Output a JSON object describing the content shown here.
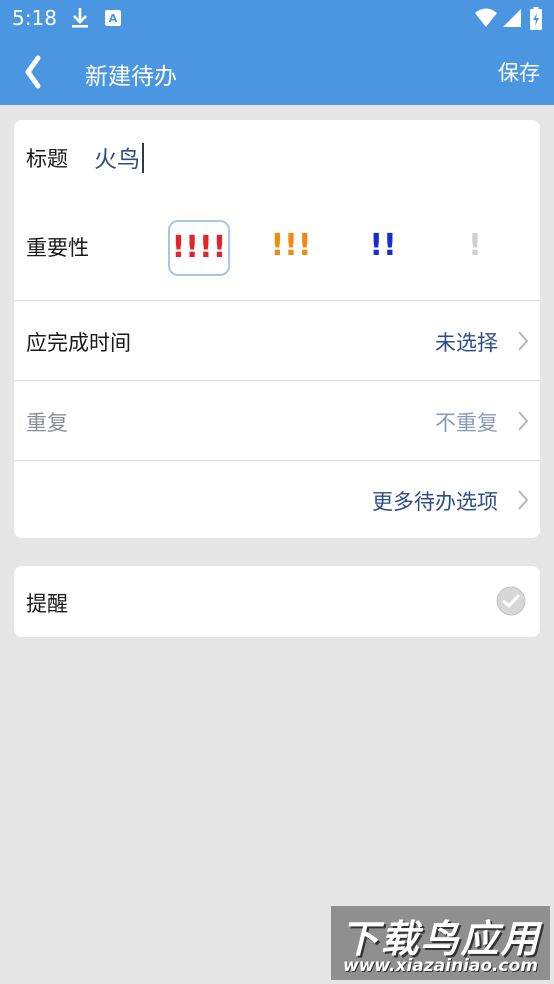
{
  "status_bar": {
    "time": "5:18",
    "icons": [
      "download-icon",
      "text-a-icon",
      "wifi-icon",
      "cellular-signal-icon",
      "battery-charging-icon"
    ]
  },
  "app_bar": {
    "back_icon": "chevron-left-icon",
    "title": "新建待办",
    "save_label": "保存"
  },
  "form": {
    "title_label": "标题",
    "title_value": "火鸟",
    "importance_label": "重要性",
    "importance_options": [
      {
        "marks": "!!!!",
        "color": "#e3242b",
        "selected": true
      },
      {
        "marks": "!!!",
        "color": "#f08a15",
        "selected": false
      },
      {
        "marks": "!!",
        "color": "#1b2bd6",
        "selected": false
      },
      {
        "marks": "!",
        "color": "#cfcfcf",
        "selected": false
      }
    ],
    "due_time_label": "应完成时间",
    "due_time_value": "未选择",
    "repeat_label": "重复",
    "repeat_value": "不重复",
    "more_options_label": "更多待办选项"
  },
  "reminder": {
    "label": "提醒",
    "enabled": false
  },
  "watermark": {
    "line1": "下载鸟应用",
    "line2": "www.xiazainiao.com"
  },
  "colors": {
    "primary": "#4b96e1",
    "value_text": "#2f4e86",
    "background": "#e6e6e6"
  }
}
